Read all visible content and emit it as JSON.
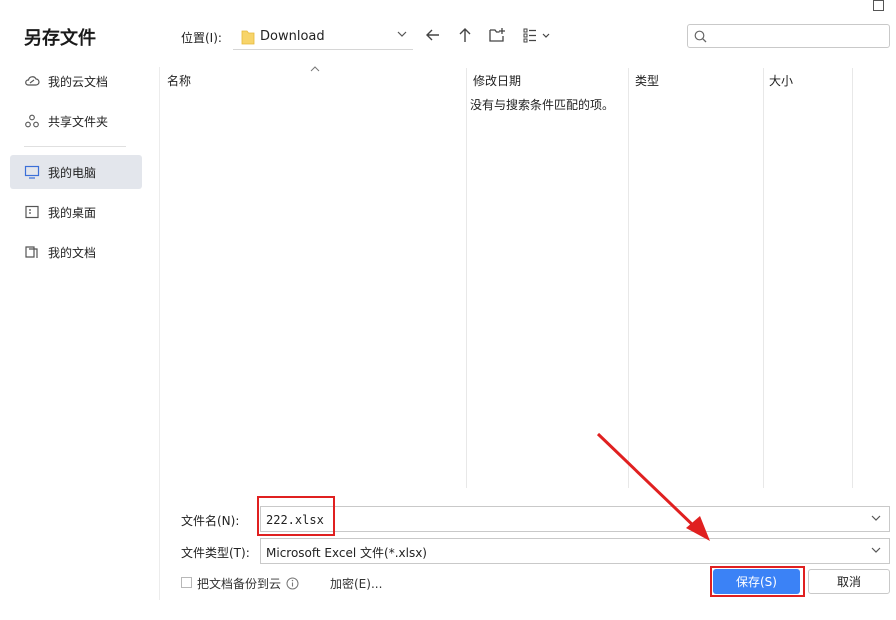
{
  "dialog": {
    "title": "另存文件"
  },
  "sidebar": {
    "items": [
      {
        "label": "我的云文档",
        "icon": "cloud-icon",
        "active": false
      },
      {
        "label": "共享文件夹",
        "icon": "share-icon",
        "active": false
      },
      {
        "label": "我的电脑",
        "icon": "monitor-icon",
        "active": true
      },
      {
        "label": "我的桌面",
        "icon": "desktop-icon",
        "active": false
      },
      {
        "label": "我的文档",
        "icon": "documents-icon",
        "active": false
      }
    ]
  },
  "location": {
    "label": "位置(I):",
    "value": "Download"
  },
  "search": {
    "placeholder": ""
  },
  "columns": [
    "名称",
    "修改日期",
    "类型",
    "大小"
  ],
  "empty_message": "没有与搜索条件匹配的项。",
  "filename": {
    "label": "文件名(N):",
    "value": "222.xlsx"
  },
  "filetype": {
    "label": "文件类型(T):",
    "value": "Microsoft Excel 文件(*.xlsx)"
  },
  "backup": {
    "label": "把文档备份到云",
    "checked": false
  },
  "encrypt_label": "加密(E)...",
  "buttons": {
    "save": "保存(S)",
    "cancel": "取消"
  },
  "colors": {
    "accent": "#3b82f6",
    "highlight": "#e02020",
    "sidebar_active": "#e3e6ec"
  }
}
